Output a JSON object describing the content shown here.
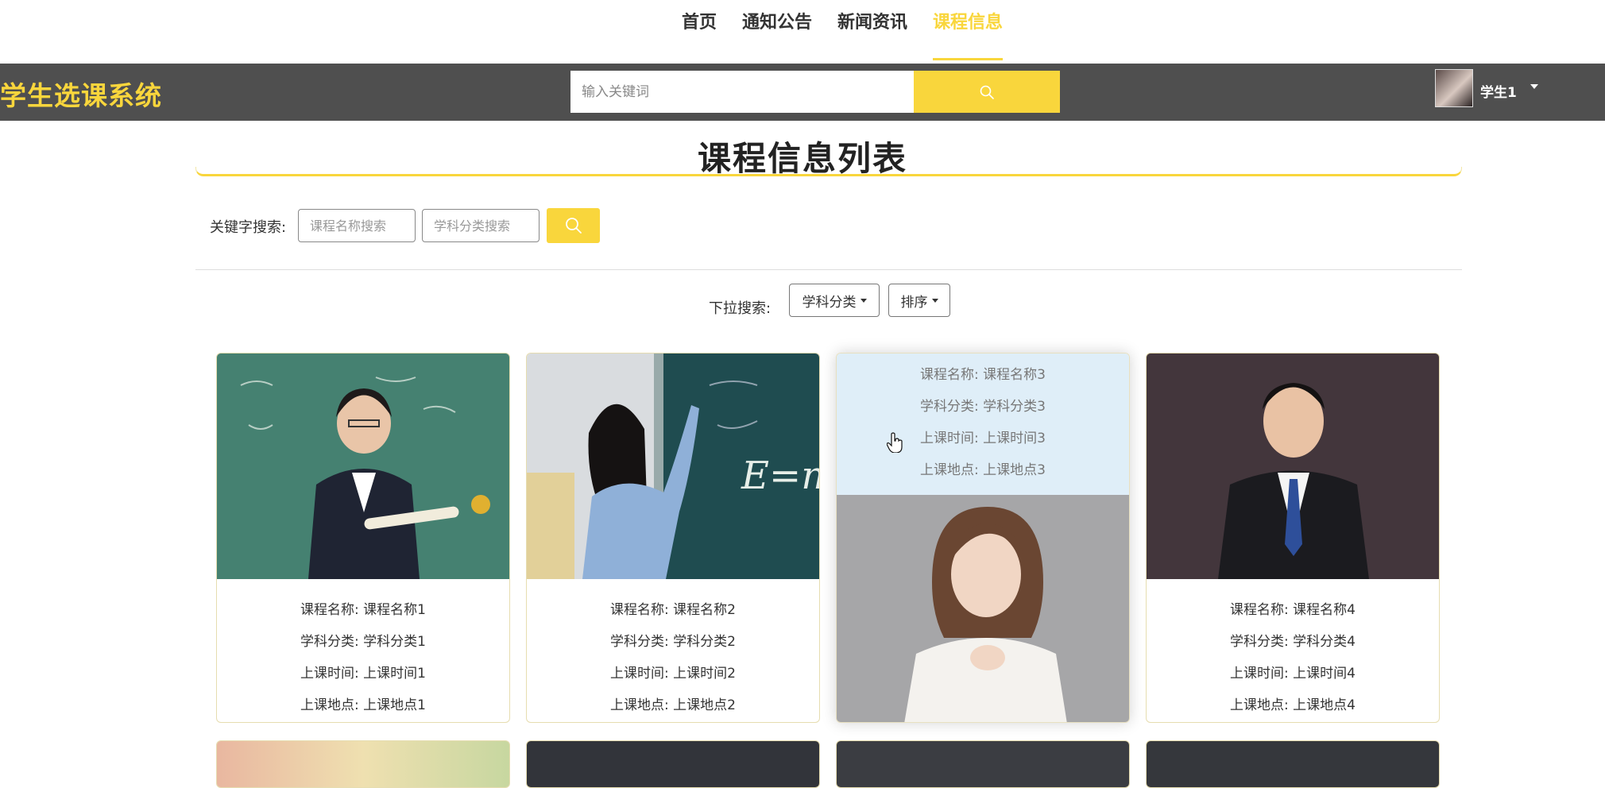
{
  "nav": {
    "items": [
      {
        "label": "首页"
      },
      {
        "label": "通知公告"
      },
      {
        "label": "新闻资讯"
      },
      {
        "label": "课程信息",
        "active": true
      }
    ]
  },
  "header": {
    "brand": "学生选课系统",
    "search_placeholder": "输入关键词",
    "search_icon": "search-icon",
    "user_name": "学生1"
  },
  "page": {
    "title": "课程信息列表"
  },
  "keyword_search": {
    "label": "关键字搜索:",
    "name_placeholder": "课程名称搜索",
    "category_placeholder": "学科分类搜索"
  },
  "dropdown_search": {
    "label": "下拉搜索:",
    "category_button": "学科分类",
    "sort_button": "排序"
  },
  "courses": [
    {
      "name_line": "课程名称: 课程名称1",
      "category_line": "学科分类: 学科分类1",
      "time_line": "上课时间: 上课时间1",
      "place_line": "上课地点: 上课地点1"
    },
    {
      "name_line": "课程名称: 课程名称2",
      "category_line": "学科分类: 学科分类2",
      "time_line": "上课时间: 上课时间2",
      "place_line": "上课地点: 上课地点2"
    },
    {
      "name_line": "课程名称: 课程名称3",
      "category_line": "学科分类: 学科分类3",
      "time_line": "上课时间: 上课时间3",
      "place_line": "上课地点: 上课地点3"
    },
    {
      "name_line": "课程名称: 课程名称4",
      "category_line": "学科分类: 学科分类4",
      "time_line": "上课时间: 上课时间4",
      "place_line": "上课地点: 上课地点4"
    }
  ],
  "colors": {
    "accent": "#f9d63c",
    "header_bg": "#4f4f4f",
    "hover_info_bg": "#dfeef8"
  }
}
